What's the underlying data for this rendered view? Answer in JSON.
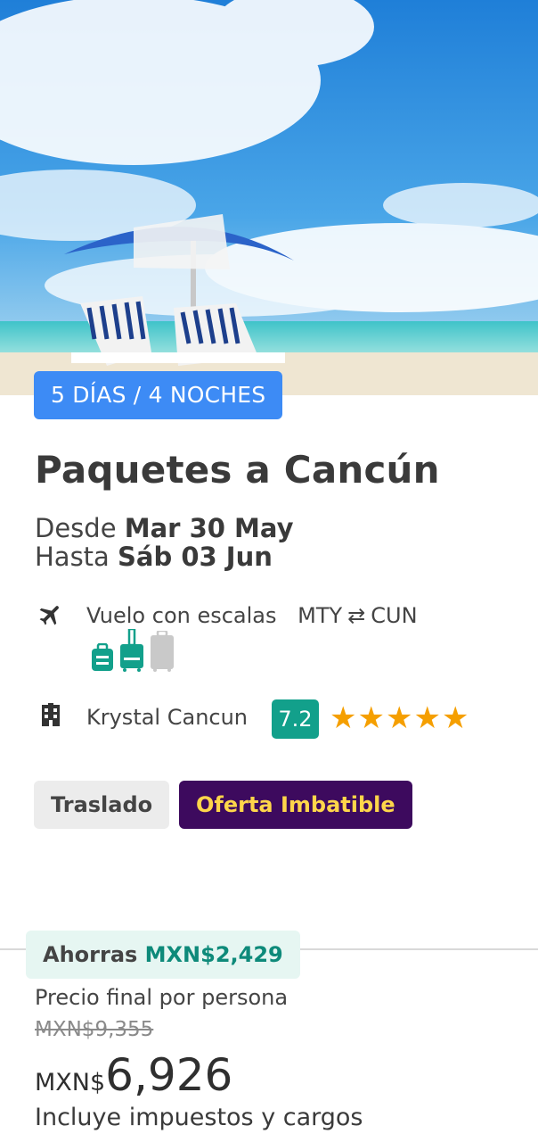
{
  "hero": {
    "image": "beach-umbrella-loungers-photo"
  },
  "package": {
    "duration_badge": "5 DÍAS / 4 NOCHES",
    "title": "Paquetes a Cancún",
    "from_label": "Desde",
    "from_date": "Mar 30 May",
    "to_label": "Hasta",
    "to_date": "Sáb 03 Jun"
  },
  "flight": {
    "icon": "airplane-icon",
    "type": "Vuelo con escalas",
    "origin": "MTY",
    "swap_icon": "swap-arrows-icon",
    "destination": "CUN",
    "luggage": [
      {
        "icon": "backpack-icon",
        "included": true
      },
      {
        "icon": "carry-on-icon",
        "included": true
      },
      {
        "icon": "checked-bag-icon",
        "included": false
      }
    ]
  },
  "hotel": {
    "icon": "building-icon",
    "name": "Krystal Cancun",
    "rating": "7.2",
    "stars": 5
  },
  "tags": {
    "transfer": "Traslado",
    "deal": "Oferta Imbatible"
  },
  "pricing": {
    "savings_label": "Ahorras",
    "savings_amount": "MXN$2,429",
    "per_person_label": "Precio final por persona",
    "old_price": "MXN$9,355",
    "currency": "MXN$",
    "price": "6,926",
    "taxes_note": "Incluye impuestos y cargos"
  },
  "colors": {
    "primary": "#3d8bf5",
    "rating": "#12a08b",
    "star": "#f59f00",
    "deal_bg": "#3d0a5e",
    "deal_text": "#ffd64a",
    "savings_bg": "#e6f6f2",
    "savings_text": "#0e8a7a"
  }
}
